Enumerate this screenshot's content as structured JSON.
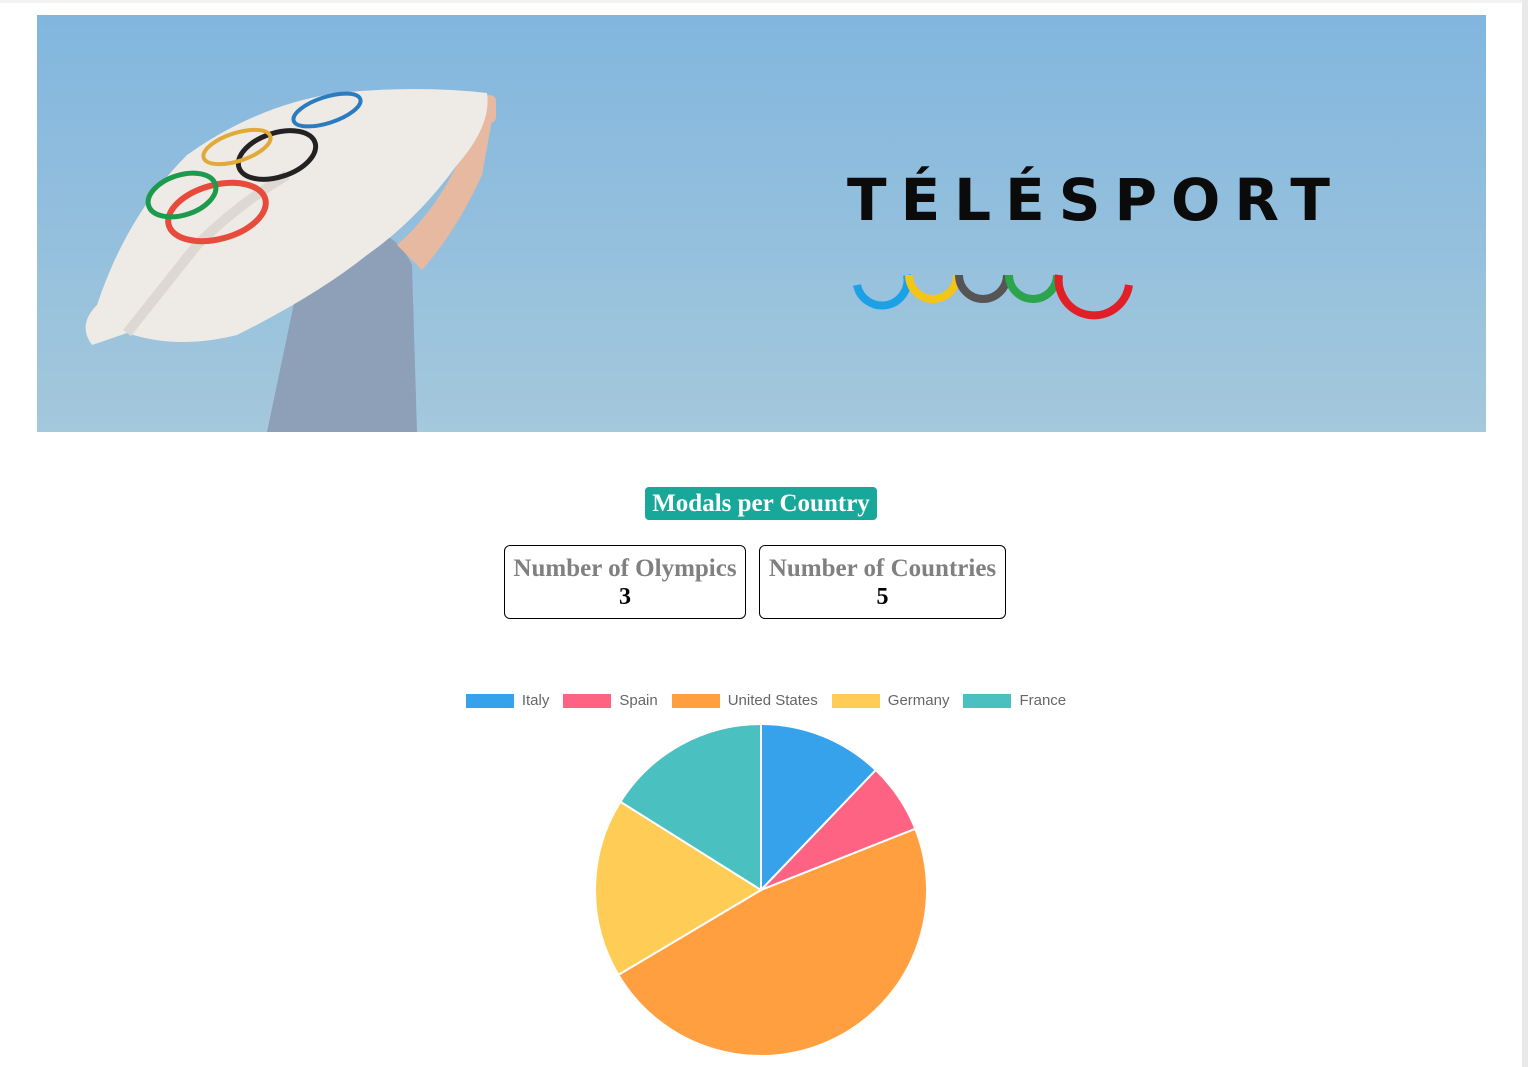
{
  "banner": {
    "brand": "TÉLÉSPORT"
  },
  "title": "Modals per Country",
  "stats": [
    {
      "label": "Number of Olympics",
      "value": "3"
    },
    {
      "label": "Number of Countries",
      "value": "5"
    }
  ],
  "chart_data": {
    "type": "pie",
    "categories": [
      "Italy",
      "Spain",
      "United States",
      "Germany",
      "France"
    ],
    "values": [
      96,
      54,
      375,
      138,
      127
    ],
    "colors": [
      "#36a2eb",
      "#ff6384",
      "#ff9f40",
      "#ffcd56",
      "#4bc0c0"
    ],
    "legend": "top",
    "title": ""
  },
  "icons": {
    "banner_image": "olympic-flag-photo",
    "brand_logo": "olympic-rings-icon"
  }
}
